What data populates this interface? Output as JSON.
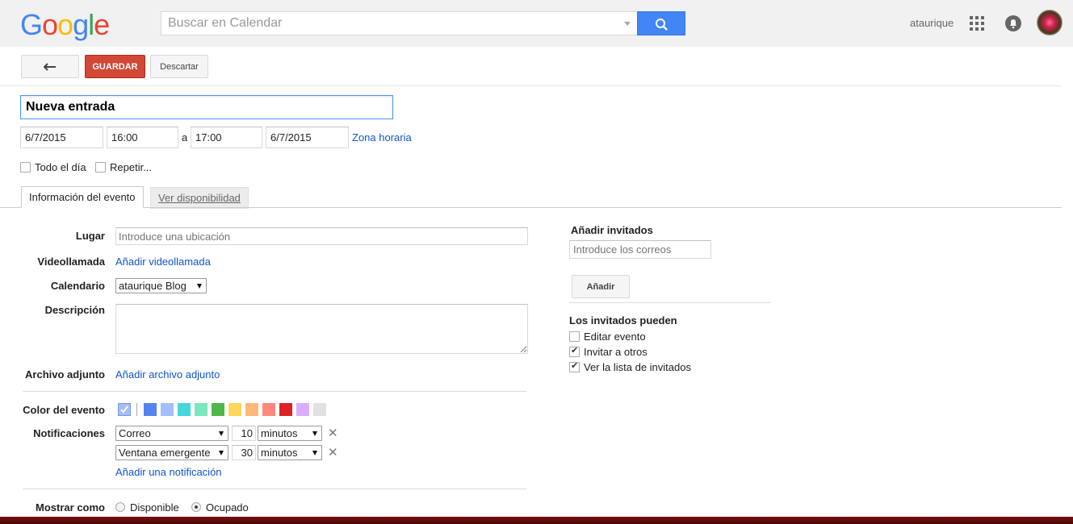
{
  "header": {
    "logo_letters": [
      {
        "char": "G",
        "color": "#4285f4"
      },
      {
        "char": "o",
        "color": "#ea4335"
      },
      {
        "char": "o",
        "color": "#fbbc05"
      },
      {
        "char": "g",
        "color": "#4285f4"
      },
      {
        "char": "l",
        "color": "#34a853"
      },
      {
        "char": "e",
        "color": "#ea4335"
      }
    ],
    "search_placeholder": "Buscar en Calendar",
    "username": "ataurique"
  },
  "toolbar": {
    "save_label": "GUARDAR",
    "discard_label": "Descartar"
  },
  "event": {
    "title": "Nueva entrada",
    "start_date": "6/7/2015",
    "start_time": "16:00",
    "to_label": "a",
    "end_time": "17:00",
    "end_date": "6/7/2015",
    "timezone_link": "Zona horaria",
    "all_day_label": "Todo el día",
    "repeat_label": "Repetir..."
  },
  "tabs": [
    {
      "label": "Información del evento",
      "active": true
    },
    {
      "label": "Ver disponibilidad",
      "active": false
    }
  ],
  "details": {
    "place_label": "Lugar",
    "place_placeholder": "Introduce una ubicación",
    "video_label": "Videollamada",
    "video_link": "Añadir videollamada",
    "calendar_label": "Calendario",
    "calendar_value": "ataurique Blog",
    "description_label": "Descripción",
    "attachment_label": "Archivo adjunto",
    "attachment_link": "Añadir archivo adjunto",
    "color_label": "Color del evento",
    "colors": [
      "#a4bdfc",
      "#5484ed",
      "#a4bdfc",
      "#46d6db",
      "#7ae7bf",
      "#51b749",
      "#fbd75b",
      "#ffb878",
      "#ff887c",
      "#dc2127",
      "#dbadff",
      "#e1e1e1"
    ],
    "notifications_label": "Notificaciones",
    "notifications": [
      {
        "method": "Correo",
        "amount": "10",
        "unit": "minutos"
      },
      {
        "method": "Ventana emergente",
        "amount": "30",
        "unit": "minutos"
      }
    ],
    "add_notification_link": "Añadir una notificación",
    "show_as_label": "Mostrar como",
    "show_as_available": "Disponible",
    "show_as_busy": "Ocupado"
  },
  "guests": {
    "title": "Añadir invitados",
    "email_placeholder": "Introduce los correos",
    "add_button": "Añadir",
    "can_title": "Los invitados pueden",
    "permissions": [
      {
        "label": "Editar evento",
        "checked": false
      },
      {
        "label": "Invitar a otros",
        "checked": true
      },
      {
        "label": "Ver la lista de invitados",
        "checked": true
      }
    ]
  }
}
